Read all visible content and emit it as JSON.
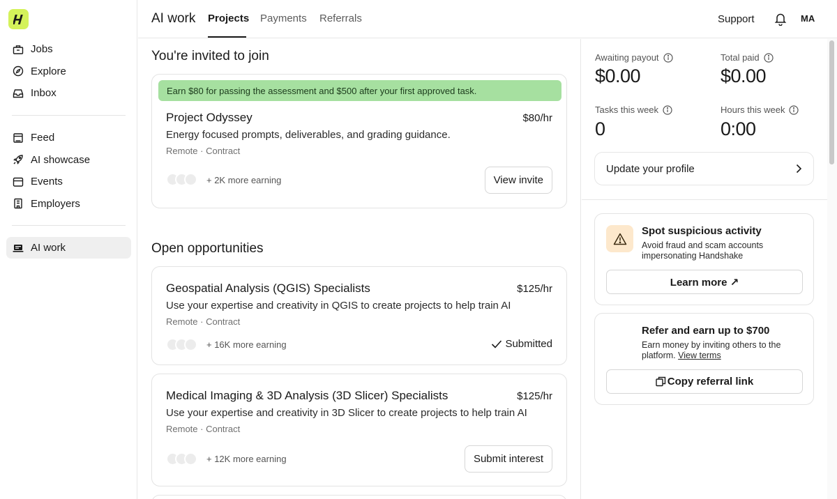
{
  "sidebar": {
    "group1": [
      {
        "label": "Jobs",
        "icon": "briefcase-icon"
      },
      {
        "label": "Explore",
        "icon": "compass-icon"
      },
      {
        "label": "Inbox",
        "icon": "inbox-icon"
      }
    ],
    "group2": [
      {
        "label": "Feed",
        "icon": "feed-icon"
      },
      {
        "label": "AI showcase",
        "icon": "rocket-icon"
      },
      {
        "label": "Events",
        "icon": "calendar-icon"
      },
      {
        "label": "Employers",
        "icon": "building-icon"
      }
    ],
    "group3": [
      {
        "label": "AI work",
        "icon": "laptop-icon",
        "active": true
      }
    ]
  },
  "header": {
    "title": "AI work",
    "tabs": [
      {
        "label": "Projects",
        "active": true
      },
      {
        "label": "Payments"
      },
      {
        "label": "Referrals"
      }
    ],
    "support": "Support",
    "avatar": "MA"
  },
  "invited": {
    "title": "You're invited to join",
    "banner": "Earn $80 for passing the assessment and $500 after your first approved task.",
    "project": {
      "title": "Project Odyssey",
      "rate": "$80/hr",
      "description": "Energy focused prompts, deliverables, and grading guidance.",
      "meta": "Remote · Contract",
      "earning": "+ 2K more earning",
      "button": "View invite"
    }
  },
  "open": {
    "title": "Open opportunities",
    "items": [
      {
        "title": "Geospatial Analysis (QGIS) Specialists",
        "rate": "$125/hr",
        "description": "Use your expertise and creativity in QGIS to create projects to help train AI",
        "meta": "Remote · Contract",
        "earning": "+ 16K more earning",
        "status": "Submitted"
      },
      {
        "title": "Medical Imaging & 3D Analysis (3D Slicer) Specialists",
        "rate": "$125/hr",
        "description": "Use your expertise and creativity in 3D Slicer to create projects to help train AI",
        "meta": "Remote · Contract",
        "earning": "+ 12K more earning",
        "button": "Submit interest"
      }
    ]
  },
  "stats": {
    "awaiting_label": "Awaiting payout",
    "awaiting_value": "$0.00",
    "total_label": "Total paid",
    "total_value": "$0.00",
    "tasks_label": "Tasks this week",
    "tasks_value": "0",
    "hours_label": "Hours this week",
    "hours_value": "0:00"
  },
  "profile": {
    "label": "Update your profile"
  },
  "suspicious": {
    "title": "Spot suspicious activity",
    "text": "Avoid fraud and scam accounts impersonating Handshake",
    "button": "Learn more ↗"
  },
  "refer": {
    "title": "Refer and earn up to $700",
    "text": "Earn money by inviting others to the platform.",
    "link": "View terms",
    "button": "Copy referral link"
  },
  "colors": {
    "brand": "#d4f25a",
    "banner": "#a6e0a0",
    "warning": "#fde8cc"
  }
}
